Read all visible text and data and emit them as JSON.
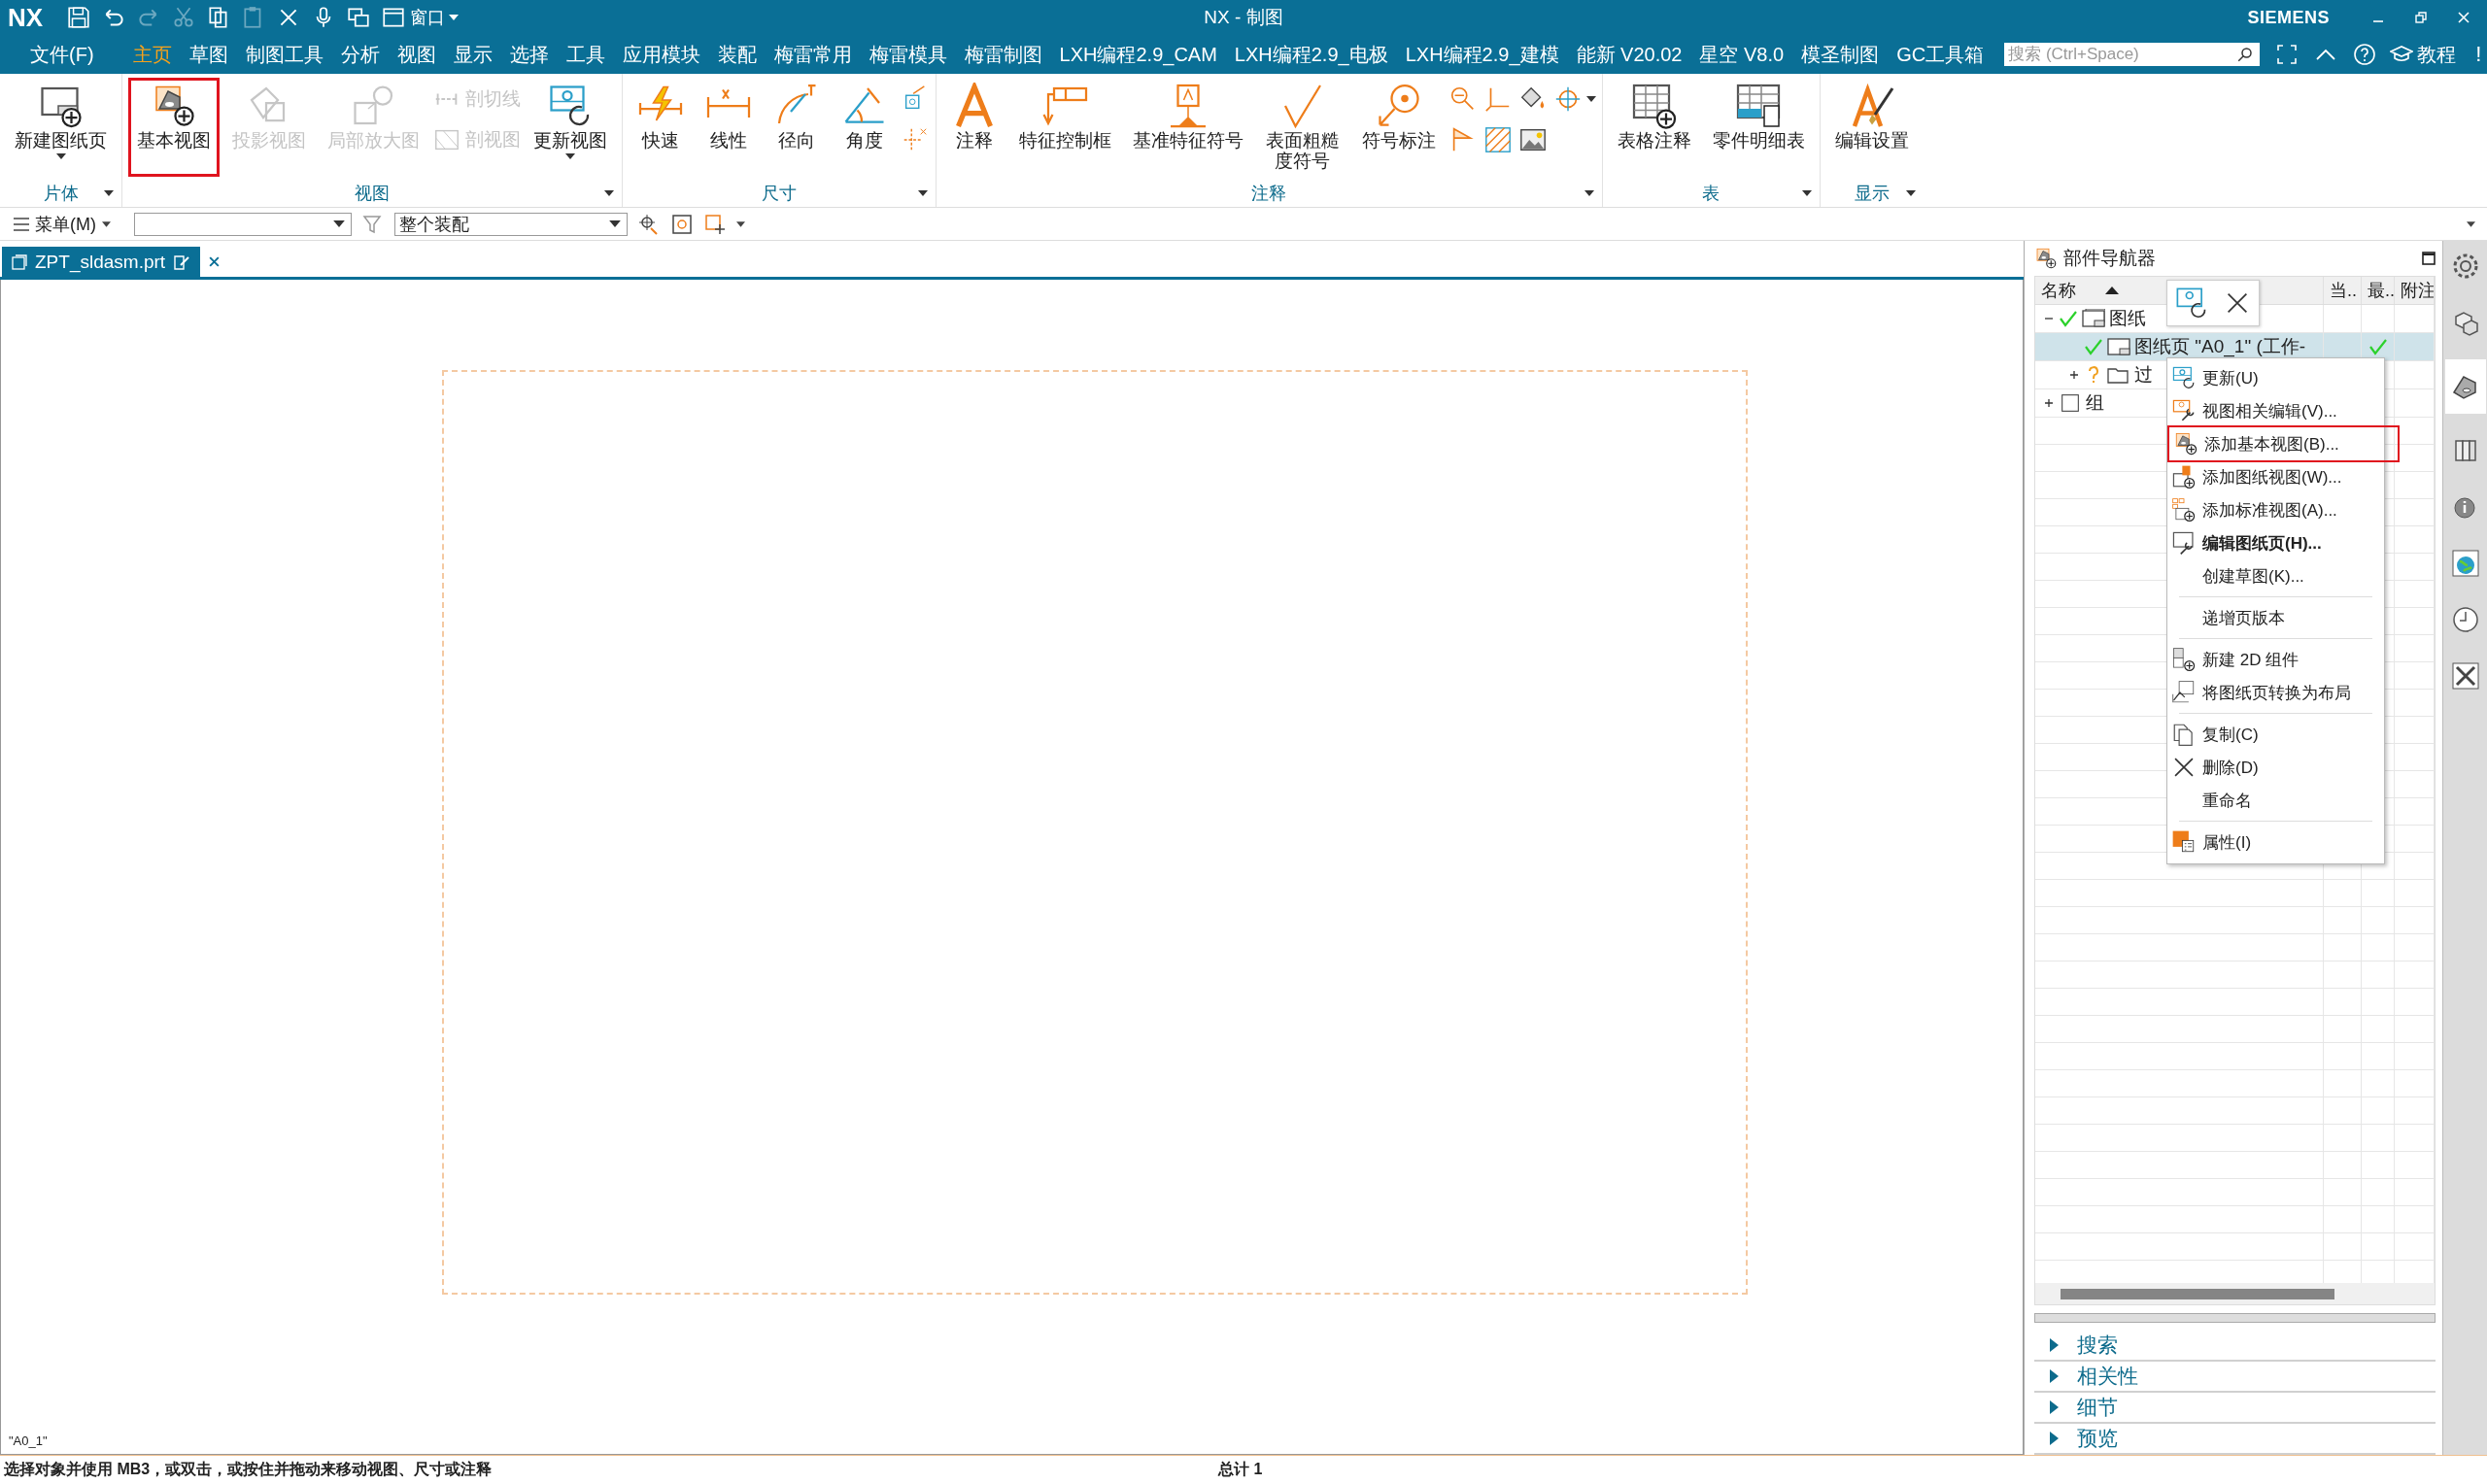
{
  "title_bar": {
    "app": "NX",
    "title": "NX - 制图",
    "brand": "SIEMENS",
    "window_menu": "窗口"
  },
  "menu_bar": {
    "items": [
      {
        "label": "文件(F)",
        "selected": false
      },
      {
        "label": "主页",
        "selected": true
      },
      {
        "label": "草图",
        "selected": false
      },
      {
        "label": "制图工具",
        "selected": false
      },
      {
        "label": "分析",
        "selected": false
      },
      {
        "label": "视图",
        "selected": false
      },
      {
        "label": "显示",
        "selected": false
      },
      {
        "label": "选择",
        "selected": false
      },
      {
        "label": "工具",
        "selected": false
      },
      {
        "label": "应用模块",
        "selected": false
      },
      {
        "label": "装配",
        "selected": false
      },
      {
        "label": "梅雷常用",
        "selected": false
      },
      {
        "label": "梅雷模具",
        "selected": false
      },
      {
        "label": "梅雷制图",
        "selected": false
      },
      {
        "label": "LXH编程2.9_CAM",
        "selected": false
      },
      {
        "label": "LXH编程2.9_电极",
        "selected": false
      },
      {
        "label": "LXH编程2.9_建模",
        "selected": false
      },
      {
        "label": "能新 V20.02",
        "selected": false
      },
      {
        "label": "星空 V8.0",
        "selected": false
      },
      {
        "label": "模圣制图",
        "selected": false
      },
      {
        "label": "GC工具箱",
        "selected": false
      }
    ],
    "search": {
      "placeholder": "搜索 (Ctrl+Space)"
    },
    "help_label": "教程",
    "alert": "!"
  },
  "ribbon": {
    "groups": [
      {
        "label": "片体",
        "items": [
          {
            "label": "新建图纸页",
            "kind": "large",
            "disabled": false,
            "dropdown": true
          }
        ]
      },
      {
        "label": "视图",
        "items": [
          {
            "label": "基本视图",
            "kind": "large",
            "disabled": false,
            "dropdown": false,
            "highlighted": true
          },
          {
            "label": "投影视图",
            "kind": "large",
            "disabled": true,
            "dropdown": false
          },
          {
            "label": "局部放大图",
            "kind": "large",
            "disabled": true,
            "dropdown": false
          },
          {
            "label": "剖切线",
            "kind": "small",
            "disabled": true,
            "dropdown": false
          },
          {
            "label": "剖视图",
            "kind": "small",
            "disabled": true,
            "dropdown": false
          },
          {
            "label": "更新视图",
            "kind": "large",
            "disabled": false,
            "dropdown": true
          }
        ]
      },
      {
        "label": "尺寸",
        "items": [
          {
            "label": "快速",
            "kind": "large",
            "disabled": false,
            "dropdown": false
          },
          {
            "label": "线性",
            "kind": "large",
            "disabled": false,
            "dropdown": false
          },
          {
            "label": "径向",
            "kind": "large",
            "disabled": false,
            "dropdown": false
          },
          {
            "label": "角度",
            "kind": "large",
            "disabled": false,
            "dropdown": false
          },
          {
            "kind": "icon",
            "disabled": false,
            "dropdown": false
          },
          {
            "kind": "icon",
            "disabled": false,
            "dropdown": false
          }
        ]
      },
      {
        "label": "注释",
        "items": [
          {
            "label": "注释",
            "kind": "large",
            "disabled": false,
            "dropdown": false
          },
          {
            "label": "特征控制框",
            "kind": "large",
            "disabled": false,
            "dropdown": false
          },
          {
            "label": "基准特征符号",
            "kind": "large",
            "disabled": false,
            "dropdown": false
          },
          {
            "label": "表面粗糙度符号",
            "kind": "large",
            "disabled": false,
            "dropdown": false
          },
          {
            "label": "符号标注",
            "kind": "large",
            "disabled": false,
            "dropdown": false
          },
          {
            "kind": "icon",
            "disabled": false,
            "dropdown": false
          },
          {
            "kind": "icon",
            "disabled": false,
            "dropdown": false
          },
          {
            "kind": "icon",
            "disabled": false,
            "dropdown": false
          },
          {
            "kind": "icon",
            "disabled": false,
            "dropdown": true
          },
          {
            "kind": "icon",
            "disabled": false,
            "dropdown": false
          },
          {
            "kind": "icon",
            "disabled": false,
            "dropdown": false
          },
          {
            "kind": "icon",
            "disabled": false,
            "dropdown": false
          }
        ]
      },
      {
        "label": "表",
        "items": [
          {
            "label": "表格注释",
            "kind": "large",
            "disabled": false,
            "dropdown": false
          },
          {
            "label": "零件明细表",
            "kind": "large",
            "disabled": false,
            "dropdown": false
          }
        ]
      },
      {
        "label": "显示",
        "items": [
          {
            "label": "编辑设置",
            "kind": "large",
            "disabled": false,
            "dropdown": false
          }
        ]
      }
    ]
  },
  "toolbar": {
    "menu_label": "菜单(M)",
    "assembly_filter": "整个装配"
  },
  "tab": {
    "label": "ZPT_sldasm.prt",
    "selected": true
  },
  "canvas": {
    "sheet_label": "\"A0_1\""
  },
  "part_navigator": {
    "title": "部件导航器",
    "columns": [
      {
        "label": "名称",
        "sorted": true
      },
      {
        "label": "当.."
      },
      {
        "label": "最.."
      },
      {
        "label": "附注"
      }
    ],
    "tree": [
      {
        "name": "图纸",
        "kind": "sheets",
        "checked": true,
        "expanded": true,
        "selected": false,
        "latest": false,
        "children": [
          {
            "name": "图纸页 \"A0_1\" (工作-",
            "kind": "sheet",
            "checked": true,
            "selected": true,
            "latest": true
          },
          {
            "name": "过",
            "kind": "folder",
            "checked": false,
            "expanded": false,
            "selected": false,
            "latest": false
          }
        ]
      },
      {
        "name": "组",
        "kind": "group",
        "expanded": false,
        "selected": false,
        "latest": false
      }
    ],
    "sections": [
      {
        "label": "搜索",
        "expanded": false
      },
      {
        "label": "相关性",
        "expanded": false
      },
      {
        "label": "细节",
        "expanded": false
      },
      {
        "label": "预览",
        "expanded": false
      }
    ]
  },
  "context_menu": {
    "items": [
      {
        "kind": "item",
        "label": "更新(U)",
        "bold": false
      },
      {
        "kind": "item",
        "label": "视图相关编辑(V)...",
        "bold": false
      },
      {
        "kind": "item",
        "label": "添加基本视图(B)...",
        "bold": false,
        "highlighted": true
      },
      {
        "kind": "item",
        "label": "添加图纸视图(W)...",
        "bold": false
      },
      {
        "kind": "item",
        "label": "添加标准视图(A)...",
        "bold": false
      },
      {
        "kind": "item",
        "label": "编辑图纸页(H)...",
        "bold": true
      },
      {
        "kind": "item",
        "label": "创建草图(K)...",
        "bold": false
      },
      {
        "kind": "separator"
      },
      {
        "kind": "item",
        "label": "递增页版本",
        "bold": false
      },
      {
        "kind": "separator"
      },
      {
        "kind": "item",
        "label": "新建 2D 组件",
        "bold": false
      },
      {
        "kind": "item",
        "label": "将图纸页转换为布局",
        "bold": false
      },
      {
        "kind": "separator"
      },
      {
        "kind": "item",
        "label": "复制(C)",
        "bold": false
      },
      {
        "kind": "item",
        "label": "删除(D)",
        "bold": false
      },
      {
        "kind": "item",
        "label": "重命名",
        "bold": false
      },
      {
        "kind": "separator"
      },
      {
        "kind": "item",
        "label": "属性(I)",
        "bold": false
      }
    ]
  },
  "side_tabs": [
    {
      "selected": false
    },
    {
      "selected": false
    },
    {
      "selected": true
    },
    {
      "selected": false
    },
    {
      "selected": false
    },
    {
      "selected": false
    },
    {
      "selected": false
    },
    {
      "selected": false
    }
  ],
  "status_bar": {
    "message": "选择对象并使用 MB3，或双击，或按住并拖动来移动视图、尺寸或注释",
    "total": "总计 1"
  }
}
